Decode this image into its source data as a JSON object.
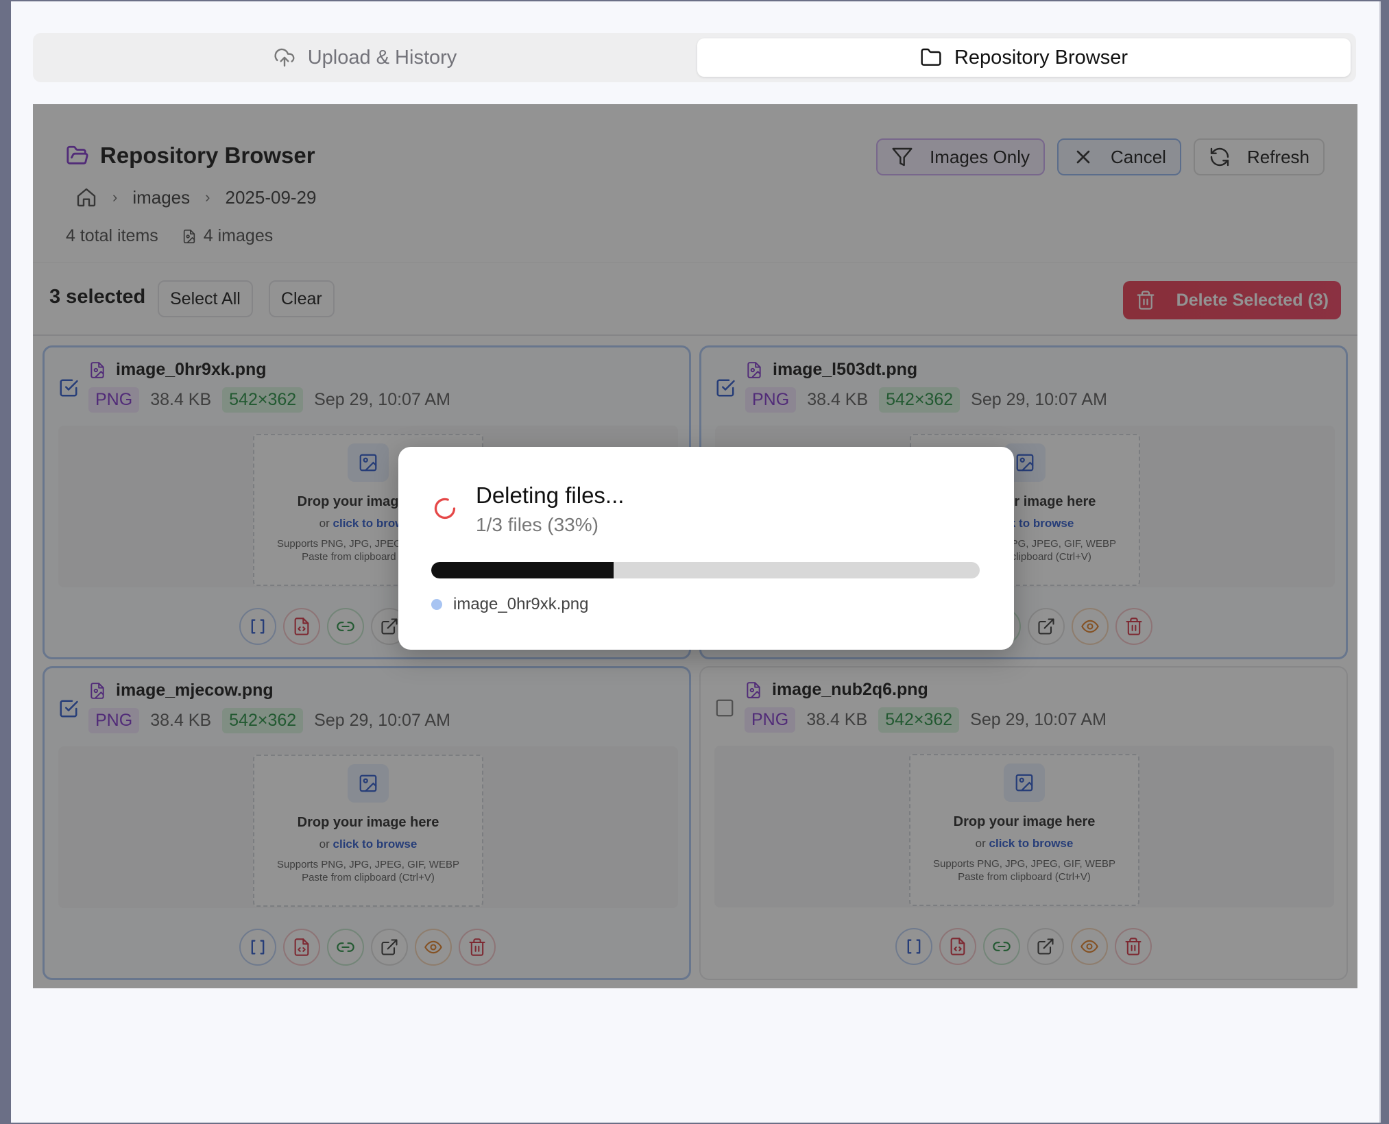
{
  "tabs": {
    "upload": "Upload & History",
    "browser": "Repository Browser"
  },
  "panel": {
    "title": "Repository Browser",
    "breadcrumb": [
      "images",
      "2025-09-29"
    ],
    "stats": {
      "total": "4 total items",
      "images": "4 images"
    },
    "buttons": {
      "images_only": "Images Only",
      "cancel": "Cancel",
      "refresh": "Refresh"
    },
    "selection": {
      "count": "3 selected",
      "select_all": "Select All",
      "clear": "Clear",
      "delete": "Delete Selected (3)"
    }
  },
  "cards": [
    {
      "name": "image_0hr9xk.png",
      "type": "PNG",
      "size": "38.4 KB",
      "dims": "542×362",
      "date": "Sep 29, 10:07 AM",
      "selected": true
    },
    {
      "name": "image_l503dt.png",
      "type": "PNG",
      "size": "38.4 KB",
      "dims": "542×362",
      "date": "Sep 29, 10:07 AM",
      "selected": true
    },
    {
      "name": "image_mjecow.png",
      "type": "PNG",
      "size": "38.4 KB",
      "dims": "542×362",
      "date": "Sep 29, 10:07 AM",
      "selected": true
    },
    {
      "name": "image_nub2q6.png",
      "type": "PNG",
      "size": "38.4 KB",
      "dims": "542×362",
      "date": "Sep 29, 10:07 AM",
      "selected": false
    }
  ],
  "dropzone": {
    "title": "Drop your image here",
    "or": "or",
    "browse": "click to browse",
    "supports": "Supports PNG, JPG, JPEG, GIF, WEBP",
    "paste": "Paste from clipboard (Ctrl+V)"
  },
  "modal": {
    "title": "Deleting files...",
    "progress_text": "1/3 files (33%)",
    "progress_fraction": 0.333,
    "current_file": "image_0hr9xk.png"
  },
  "colors": {
    "accent_purple": "#7b2fc9",
    "danger": "#e8364c",
    "selected_border": "#a8c4f2",
    "spinner": "#e54848"
  },
  "icons": [
    "upload-cloud-icon",
    "folder-icon",
    "folder-open-icon",
    "home-icon",
    "chevron-right-icon",
    "file-image-icon",
    "filter-icon",
    "close-icon",
    "refresh-icon",
    "trash-icon",
    "checkbox-checked-icon",
    "checkbox-empty-icon",
    "image-icon",
    "brackets-icon",
    "file-code-icon",
    "link-icon",
    "external-link-icon",
    "eye-icon",
    "spinner-icon"
  ]
}
